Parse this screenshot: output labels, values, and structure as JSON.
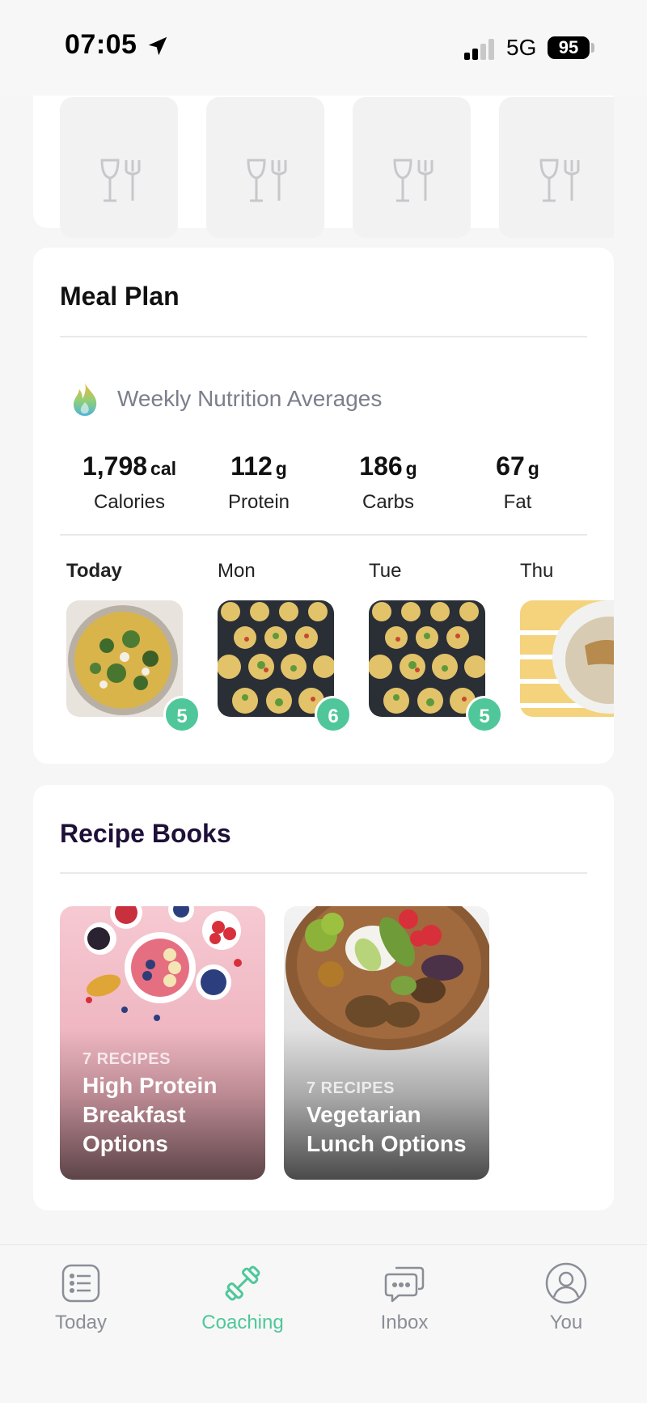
{
  "status_bar": {
    "time": "07:05",
    "network": "5G",
    "battery": "95"
  },
  "meal_plan": {
    "title": "Meal Plan",
    "subtitle": "Weekly Nutrition Averages",
    "stats": [
      {
        "value": "1,798",
        "unit": "cal",
        "label": "Calories"
      },
      {
        "value": "112",
        "unit": "g",
        "label": "Protein"
      },
      {
        "value": "186",
        "unit": "g",
        "label": "Carbs"
      },
      {
        "value": "67",
        "unit": "g",
        "label": "Fat"
      }
    ],
    "days": [
      {
        "label": "Today",
        "count": "5",
        "image": "frittata"
      },
      {
        "label": "Mon",
        "count": "6",
        "image": "egg-muffins"
      },
      {
        "label": "Tue",
        "count": "5",
        "image": "egg-muffins"
      },
      {
        "label": "Thu",
        "count": "",
        "image": "oatmeal"
      }
    ]
  },
  "recipe_books": {
    "title": "Recipe Books",
    "books": [
      {
        "count": "7 RECIPES",
        "title": "High Protein Breakfast Options"
      },
      {
        "count": "7 RECIPES",
        "title": "Vegetarian Lunch Options"
      }
    ]
  },
  "tabs": [
    {
      "label": "Today",
      "icon": "list-icon",
      "active": false
    },
    {
      "label": "Coaching",
      "icon": "dumbbell-icon",
      "active": true
    },
    {
      "label": "Inbox",
      "icon": "chat-icon",
      "active": false
    },
    {
      "label": "You",
      "icon": "user-icon",
      "active": false
    }
  ],
  "colors": {
    "accent": "#4fc79a",
    "background": "#f6f6f7",
    "title_dark": "#1e1038"
  }
}
